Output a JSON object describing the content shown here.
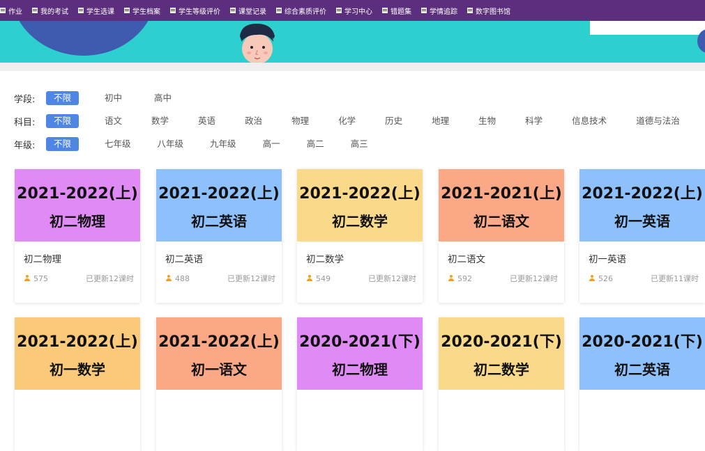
{
  "nav": [
    {
      "label": "作业"
    },
    {
      "label": "我的考试"
    },
    {
      "label": "学生选课"
    },
    {
      "label": "学生档案"
    },
    {
      "label": "学生等级评价"
    },
    {
      "label": "课堂记录"
    },
    {
      "label": "综合素质评价"
    },
    {
      "label": "学习中心"
    },
    {
      "label": "错题集"
    },
    {
      "label": "学情追踪"
    },
    {
      "label": "数字图书馆"
    }
  ],
  "filters": {
    "stage": {
      "label": "学段:",
      "options": [
        "不限",
        "初中",
        "高中"
      ],
      "active": 0
    },
    "subject": {
      "label": "科目:",
      "options": [
        "不限",
        "语文",
        "数学",
        "英语",
        "政治",
        "物理",
        "化学",
        "历史",
        "地理",
        "生物",
        "科学",
        "信息技术",
        "道德与法治"
      ],
      "active": 0
    },
    "grade": {
      "label": "年级:",
      "options": [
        "不限",
        "七年级",
        "八年级",
        "九年级",
        "高一",
        "高二",
        "高三"
      ],
      "active": 0
    }
  },
  "cards": [
    {
      "cover_year": "2021-2022(上)",
      "cover_subject": "初二物理",
      "title": "初二物理",
      "count": "575",
      "updated": "已更新12课时",
      "color": "#e08bf5"
    },
    {
      "cover_year": "2021-2022(上)",
      "cover_subject": "初二英语",
      "title": "初二英语",
      "count": "488",
      "updated": "已更新12课时",
      "color": "#8ec0fb"
    },
    {
      "cover_year": "2021-2022(上)",
      "cover_subject": "初二数学",
      "title": "初二数学",
      "count": "549",
      "updated": "已更新12课时",
      "color": "#fbd98a"
    },
    {
      "cover_year": "2021-2021(上)",
      "cover_subject": "初二语文",
      "title": "初二语文",
      "count": "592",
      "updated": "已更新12课时",
      "color": "#fba886"
    },
    {
      "cover_year": "2021-2022(上)",
      "cover_subject": "初一英语",
      "title": "初一英语",
      "count": "526",
      "updated": "已更新11课时",
      "color": "#8ec0fb"
    },
    {
      "cover_year": "2021-2022(上)",
      "cover_subject": "初一数学",
      "title": "",
      "count": "",
      "updated": "",
      "color": "#fbc97a"
    },
    {
      "cover_year": "2021-2022(上)",
      "cover_subject": "初一语文",
      "title": "",
      "count": "",
      "updated": "",
      "color": "#fba886"
    },
    {
      "cover_year": "2020-2021(下)",
      "cover_subject": "初二物理",
      "title": "",
      "count": "",
      "updated": "",
      "color": "#e08bf5"
    },
    {
      "cover_year": "2020-2021(下)",
      "cover_subject": "初二数学",
      "title": "",
      "count": "",
      "updated": "",
      "color": "#fbd98a"
    },
    {
      "cover_year": "2020-2021(下)",
      "cover_subject": "初二英语",
      "title": "",
      "count": "",
      "updated": "",
      "color": "#8ec0fb"
    }
  ]
}
